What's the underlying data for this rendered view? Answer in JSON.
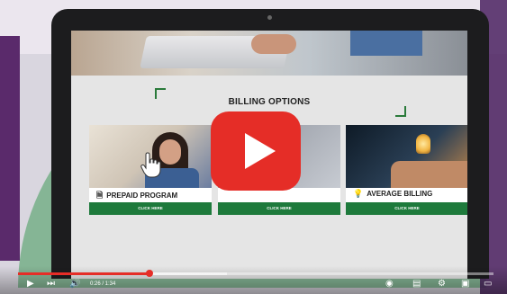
{
  "slide": {
    "title": "BILLING OPTIONS",
    "cards": [
      {
        "label": "PREPAID PROGRAM",
        "icon": "document-icon",
        "button": "CLICK HERE"
      },
      {
        "label": "",
        "icon": "",
        "button": "CLICK HERE"
      },
      {
        "label": "AVERAGE BILLING",
        "icon": "lightbulb-icon",
        "button": "CLICK HERE"
      }
    ]
  },
  "player": {
    "time": "0:26 / 1:34",
    "progress": 0.276,
    "buffered": 0.44,
    "accent_color": "#e52d27",
    "controls": [
      "play-icon",
      "next-icon",
      "volume-icon",
      "toggle-icon",
      "subtitles-icon",
      "settings-icon",
      "miniplayer-icon",
      "theater-icon"
    ]
  },
  "colors": {
    "button_green": "#1e7a3c",
    "brand_red": "#e52d27"
  }
}
